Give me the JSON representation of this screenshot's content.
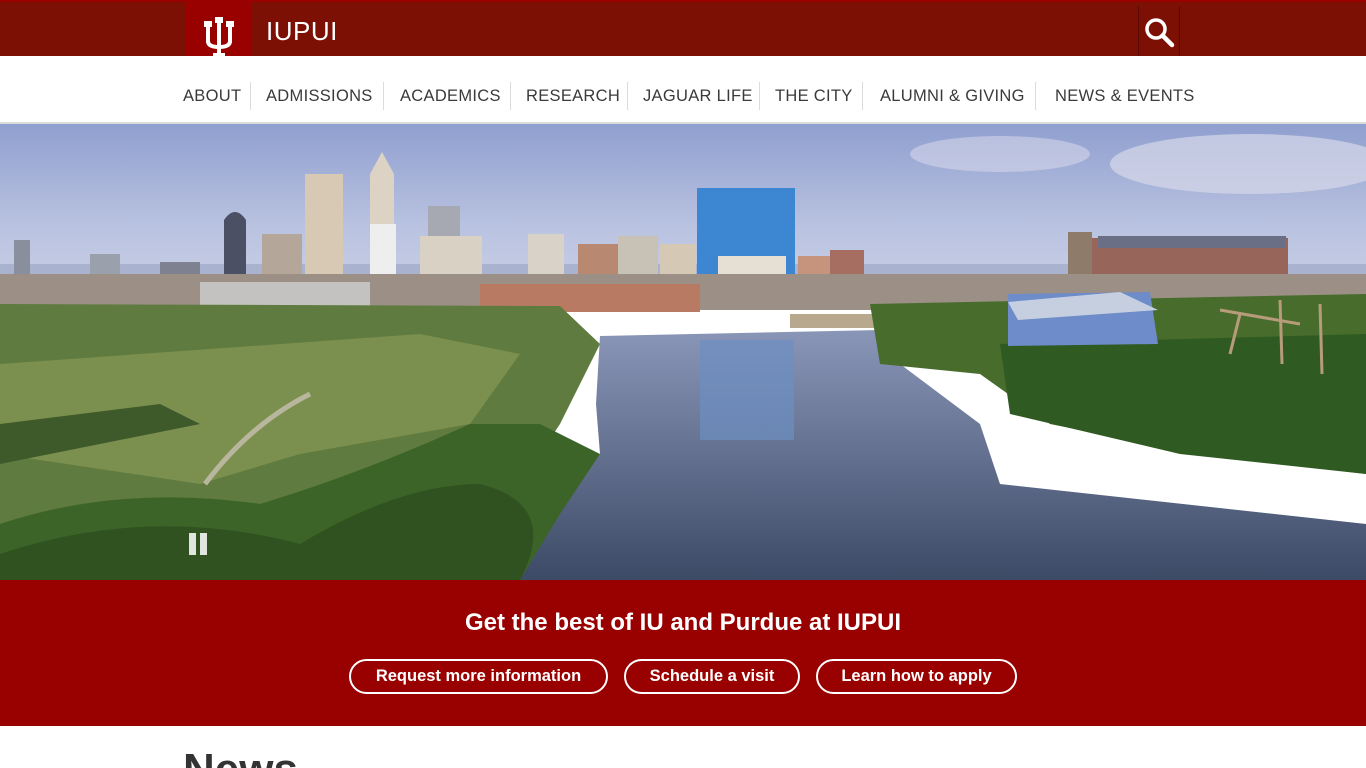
{
  "header": {
    "site_title": "IUPUI",
    "logo_icon": "iu-trident-logo",
    "search_icon": "search-icon"
  },
  "nav": {
    "items": [
      {
        "label": "ABOUT"
      },
      {
        "label": "ADMISSIONS"
      },
      {
        "label": "ACADEMICS"
      },
      {
        "label": "RESEARCH"
      },
      {
        "label": "JAGUAR LIFE"
      },
      {
        "label": "THE CITY"
      },
      {
        "label": "ALUMNI & GIVING"
      },
      {
        "label": "NEWS & EVENTS"
      }
    ]
  },
  "hero": {
    "image": "indianapolis-skyline-over-white-river",
    "pause_icon": "pause-icon"
  },
  "cta": {
    "title": "Get the best of IU and Purdue at IUPUI",
    "buttons": [
      {
        "label": "Request more information"
      },
      {
        "label": "Schedule a visit"
      },
      {
        "label": "Learn how to apply"
      }
    ]
  },
  "news": {
    "heading": "News"
  },
  "colors": {
    "topbar": "#7d1004",
    "crimson": "#990000",
    "nav_text": "#3a3a3a"
  }
}
